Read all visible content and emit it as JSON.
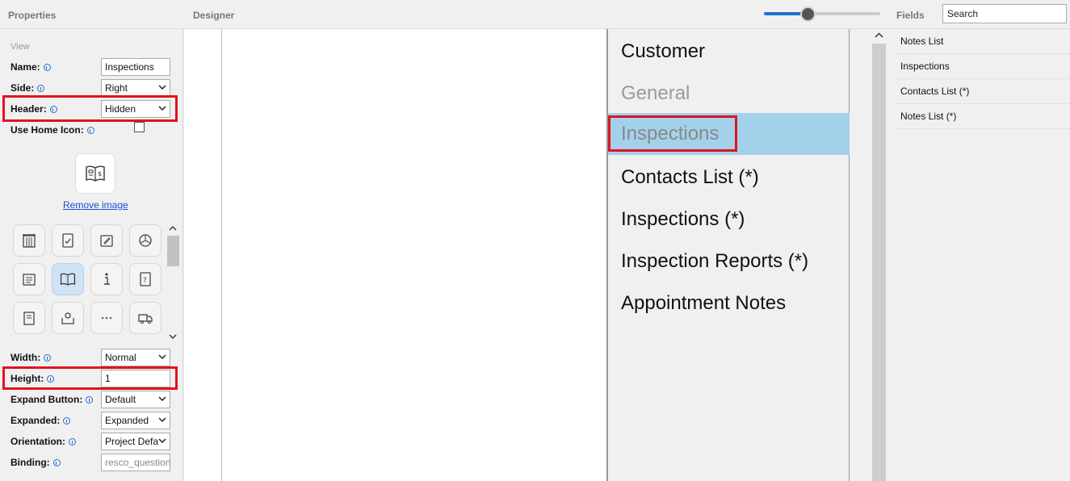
{
  "properties": {
    "title": "Properties",
    "section": "View",
    "name": {
      "label": "Name:",
      "value": "Inspections"
    },
    "side": {
      "label": "Side:",
      "value": "Right"
    },
    "header": {
      "label": "Header:",
      "value": "Hidden"
    },
    "use_home_icon": {
      "label": "Use Home Icon:",
      "checked": false
    },
    "remove_image": "Remove image",
    "icons": [
      "building-icon",
      "checklist-icon",
      "edit-icon",
      "pie-chart-icon",
      "clipboard-icon",
      "ledger-icon",
      "info-icon",
      "help-document-icon",
      "notepad-icon",
      "map-pin-icon",
      "more-icon",
      "delivery-truck-icon"
    ],
    "selected_icon": "ledger-icon",
    "width": {
      "label": "Width:",
      "value": "Normal"
    },
    "height": {
      "label": "Height:",
      "value": "1"
    },
    "expand_button": {
      "label": "Expand Button:",
      "value": "Default"
    },
    "expanded": {
      "label": "Expanded:",
      "value": "Expanded"
    },
    "orientation": {
      "label": "Orientation:",
      "value": "Project Defa"
    },
    "binding": {
      "label": "Binding:",
      "placeholder": "resco_question"
    }
  },
  "designer": {
    "title": "Designer",
    "zoom_level": 0.36,
    "menu": [
      {
        "label": "Customer",
        "state": "normal"
      },
      {
        "label": "General",
        "state": "muted"
      },
      {
        "label": "Inspections",
        "state": "selected"
      },
      {
        "label": "Contacts List (*)",
        "state": "normal"
      },
      {
        "label": "Inspections (*)",
        "state": "normal"
      },
      {
        "label": "Inspection Reports (*)",
        "state": "normal"
      },
      {
        "label": "Appointment Notes",
        "state": "normal"
      }
    ]
  },
  "fields": {
    "title": "Fields",
    "search_value": "Search",
    "items": [
      "Notes List",
      "Inspections",
      "Contacts List (*)",
      "Notes List (*)"
    ]
  },
  "colors": {
    "highlight": "#e0141e",
    "selected_row": "#a3d1ea",
    "accent": "#1e6fd0"
  }
}
